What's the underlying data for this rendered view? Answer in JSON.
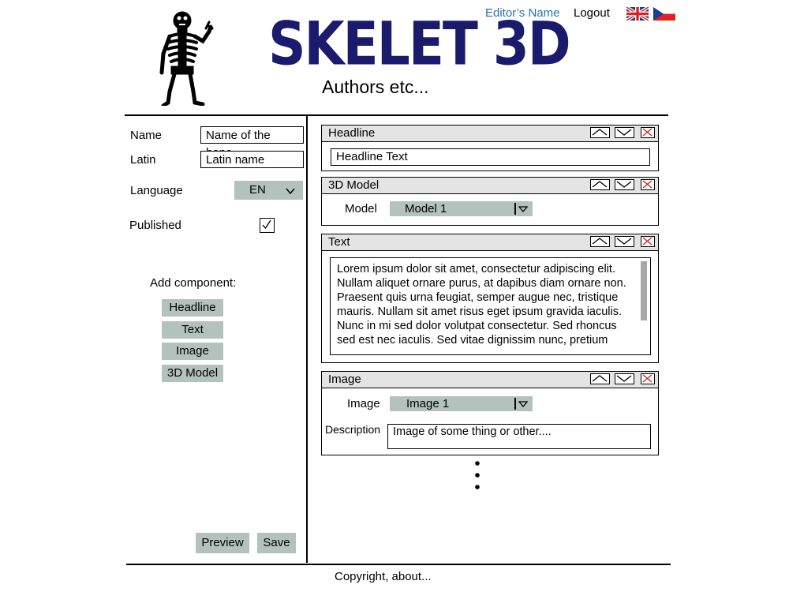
{
  "header": {
    "brand": "SKELET 3D",
    "subtitle": "Authors etc...",
    "editor_name": "Editor’s Name",
    "logout": "Logout",
    "flags": [
      "uk-flag-icon",
      "cz-flag-icon"
    ]
  },
  "sidebar": {
    "name_label": "Name",
    "name_value": "Name of the bone",
    "latin_label": "Latin",
    "latin_value": "Latin name",
    "language_label": "Language",
    "language_value": "EN",
    "published_label": "Published",
    "published_checked": true,
    "add_component_label": "Add component:",
    "components": [
      "Headline",
      "Text",
      "Image",
      "3D Model"
    ],
    "preview_label": "Preview",
    "save_label": "Save"
  },
  "panels": {
    "headline": {
      "title": "Headline",
      "value": "Headline Text"
    },
    "model": {
      "title": "3D Model",
      "field_label": "Model",
      "selected": "Model 1"
    },
    "text": {
      "title": "Text",
      "lines": [
        "Lorem ipsum dolor sit amet, consectetur adipiscing elit.",
        "Nullam aliquet ornare purus, at dapibus diam ornare non.",
        "Praesent quis urna feugiat, semper augue nec, tristique",
        "mauris. Nullam sit amet risus eget ipsum gravida iaculis.",
        "Nunc in mi sed dolor volutpat consectetur. Sed rhoncus",
        "sed est nec iaculis. Sed vitae dignissim nunc, pretium"
      ]
    },
    "image": {
      "title": "Image",
      "field_label": "Image",
      "selected": "Image 1",
      "description_label": "Description",
      "description_value": "Image of some thing or other...."
    }
  },
  "footer": {
    "text": "Copyright, about..."
  },
  "colors": {
    "brand": "#1b1b6e",
    "link": "#2a6fb8",
    "button": "#b3c2bc",
    "panel_header": "#e4e4e4",
    "close": "#d22222"
  }
}
